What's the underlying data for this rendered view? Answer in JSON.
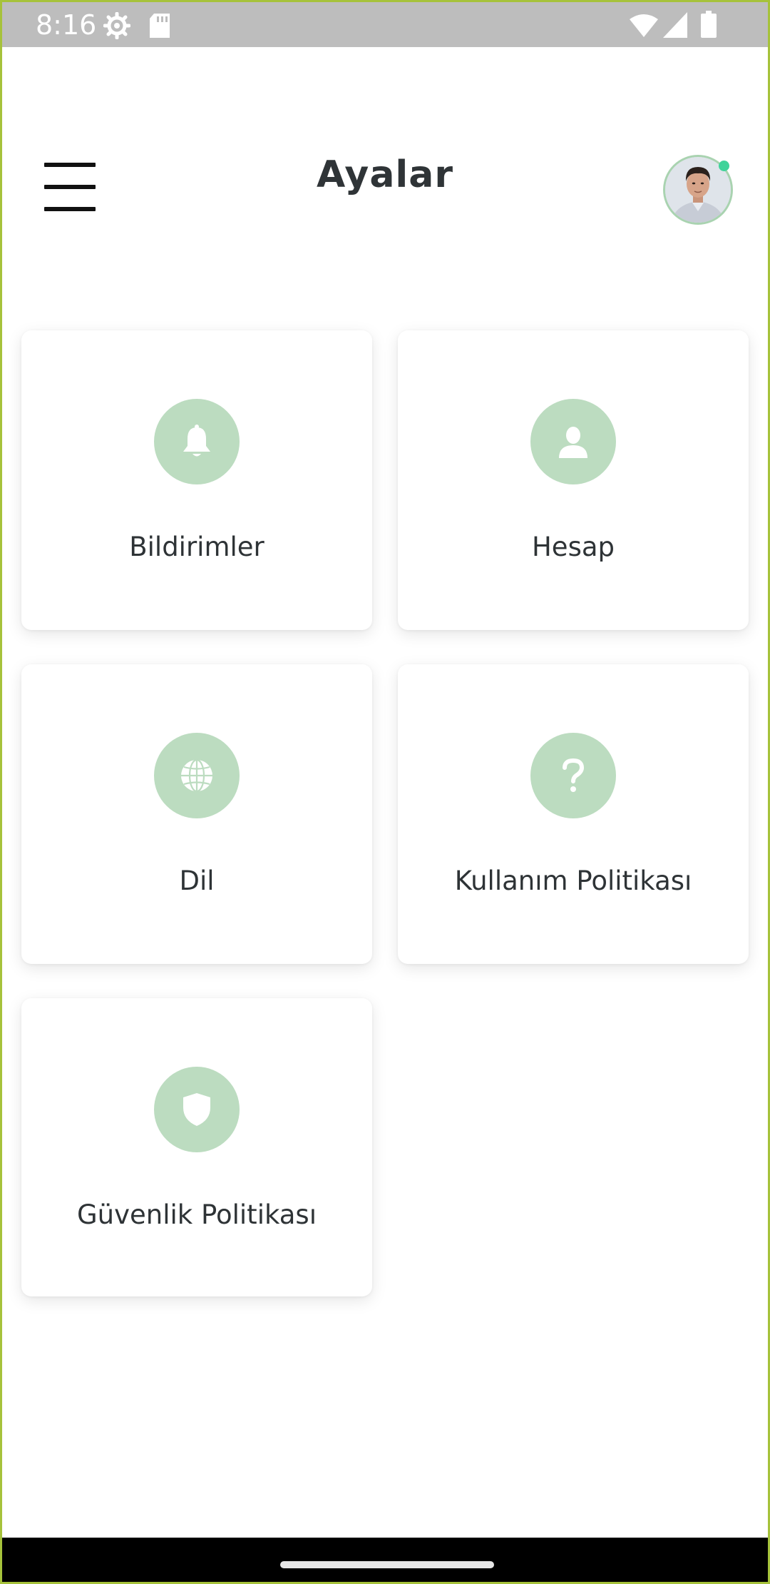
{
  "status_bar": {
    "time": "8:16",
    "icons": [
      "settings-gear-icon",
      "sd-card-icon",
      "wifi-icon",
      "signal-icon",
      "battery-icon"
    ]
  },
  "header": {
    "title": "Ayalar",
    "menu_icon": "hamburger-menu-icon",
    "avatar_status_color": "#3fd39a"
  },
  "settings": {
    "items": [
      {
        "label": "Bildirimler",
        "icon": "bell-icon"
      },
      {
        "label": "Hesap",
        "icon": "user-icon"
      },
      {
        "label": "Dil",
        "icon": "globe-icon"
      },
      {
        "label": "Kullanım Politikası",
        "icon": "question-icon"
      },
      {
        "label": "Güvenlik Politikası",
        "icon": "shield-icon"
      }
    ]
  },
  "colors": {
    "accent": "#bcdcc0",
    "title": "#2f3437",
    "frame": "#a6c23b"
  }
}
